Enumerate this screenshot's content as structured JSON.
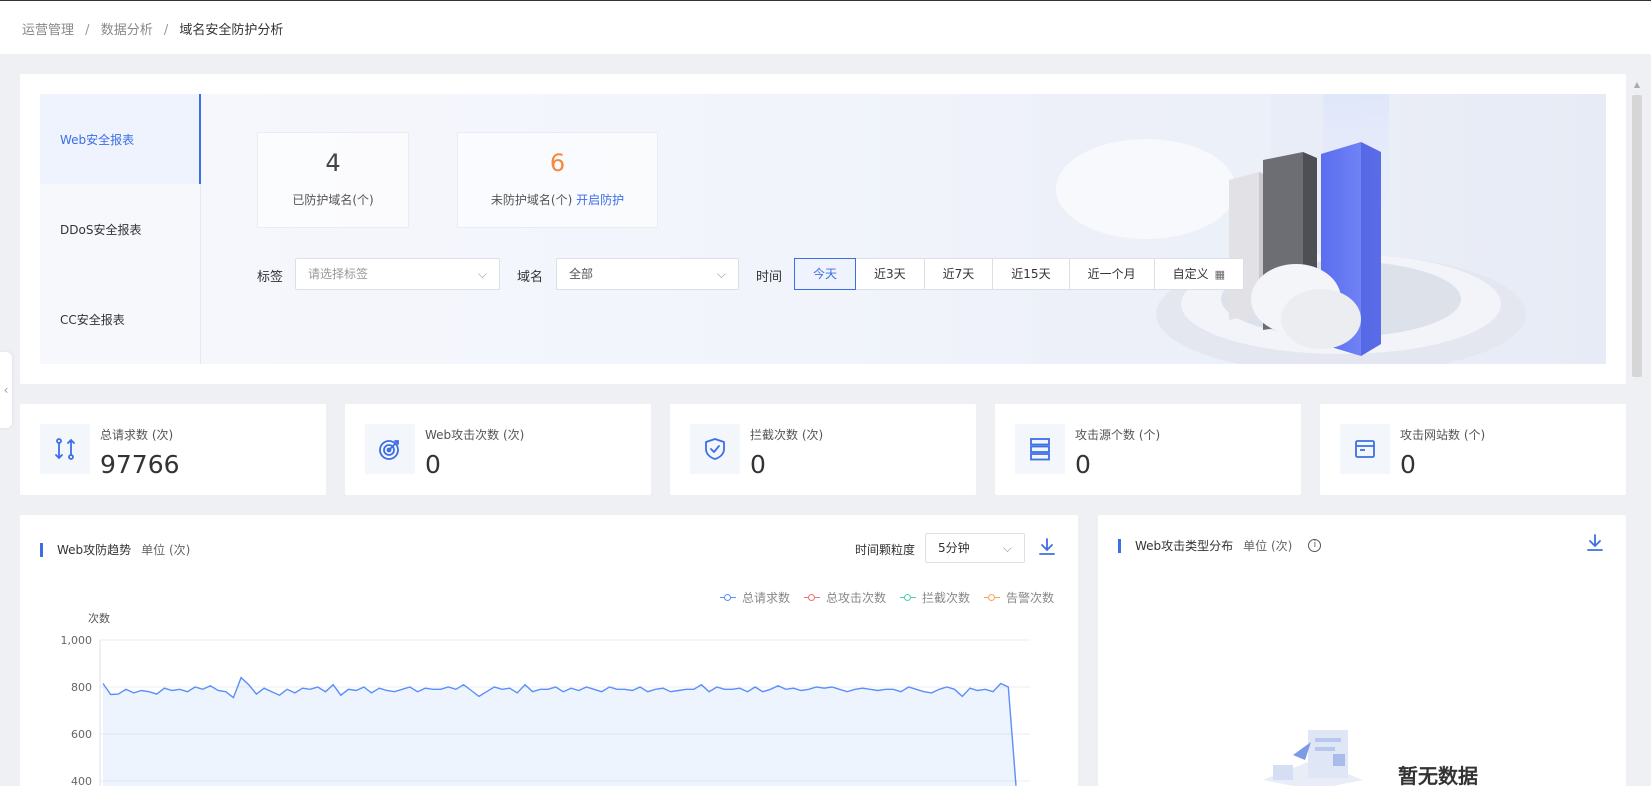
{
  "breadcrumb": {
    "items": [
      "运营管理",
      "数据分析",
      "域名安全防护分析"
    ],
    "separator": "/"
  },
  "report_nav": {
    "items": [
      {
        "label": "Web安全报表",
        "active": true
      },
      {
        "label": "DDoS安全报表",
        "active": false
      },
      {
        "label": "CC安全报表",
        "active": false
      }
    ]
  },
  "summary": {
    "protected": {
      "value": "4",
      "label": "已防护域名(个)"
    },
    "unprotected": {
      "value": "6",
      "label": "未防护域名(个)",
      "link": "开启防护"
    }
  },
  "filters": {
    "tag_label": "标签",
    "tag_placeholder": "请选择标签",
    "domain_label": "域名",
    "domain_value": "全部",
    "time_label": "时间",
    "time_options": [
      "今天",
      "近3天",
      "近7天",
      "近15天",
      "近一个月",
      "自定义"
    ],
    "time_selected": "今天"
  },
  "metrics": [
    {
      "icon": "request-arrows-icon",
      "label": "总请求数 (次)",
      "value": "97766"
    },
    {
      "icon": "target-icon",
      "label": "Web攻击次数 (次)",
      "value": "0"
    },
    {
      "icon": "shield-check-icon",
      "label": "拦截次数 (次)",
      "value": "0"
    },
    {
      "icon": "server-stack-icon",
      "label": "攻击源个数 (个)",
      "value": "0"
    },
    {
      "icon": "browser-window-icon",
      "label": "攻击网站数 (个)",
      "value": "0"
    }
  ],
  "trend_panel": {
    "title": "Web攻防趋势",
    "unit": "单位 (次)",
    "granularity_label": "时间颗粒度",
    "granularity_value": "5分钟",
    "legend": [
      {
        "name": "总请求数",
        "color": "#5b8ff9"
      },
      {
        "name": "总攻击次数",
        "color": "#f27070"
      },
      {
        "name": "拦截次数",
        "color": "#4ecfb0"
      },
      {
        "name": "告警次数",
        "color": "#f7a35c"
      }
    ]
  },
  "type_panel": {
    "title": "Web攻击类型分布",
    "unit": "单位 (次)",
    "empty_text": "暂无数据"
  },
  "chart_data": {
    "type": "area",
    "ylabel": "次数",
    "ylim": [
      400,
      1000
    ],
    "yticks": [
      "1,000",
      "800",
      "600",
      "400"
    ],
    "series": [
      {
        "name": "总请求数",
        "color": "#5b8ff9",
        "values": [
          815,
          768,
          770,
          790,
          775,
          785,
          780,
          770,
          795,
          785,
          790,
          780,
          800,
          790,
          805,
          785,
          780,
          755,
          840,
          810,
          770,
          795,
          780,
          765,
          790,
          775,
          795,
          790,
          800,
          780,
          810,
          765,
          790,
          785,
          800,
          775,
          795,
          785,
          780,
          790,
          800,
          780,
          795,
          790,
          790,
          800,
          790,
          810,
          785,
          760,
          780,
          800,
          790,
          795,
          775,
          810,
          780,
          790,
          790,
          800,
          780,
          795,
          785,
          800,
          790,
          780,
          800,
          790,
          790,
          785,
          800,
          780,
          790,
          795,
          780,
          785,
          790,
          790,
          810,
          780,
          800,
          790,
          790,
          795,
          780,
          800,
          780,
          790,
          805,
          790,
          795,
          785,
          790,
          800,
          795,
          800,
          790,
          780,
          790,
          795,
          790,
          785,
          790,
          790,
          780,
          800,
          790,
          780,
          775,
          790,
          800,
          790,
          760,
          795,
          785,
          790,
          780,
          815,
          800,
          380
        ]
      }
    ]
  }
}
